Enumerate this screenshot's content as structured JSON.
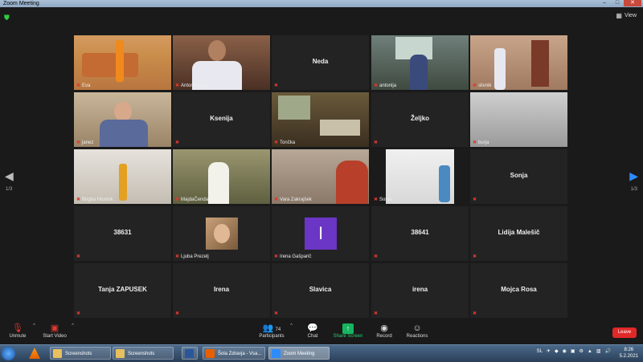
{
  "window": {
    "title": "Zoom Meeting"
  },
  "header": {
    "view_label": "View"
  },
  "pagination": {
    "left": "1/3",
    "right": "1/3"
  },
  "tiles": [
    {
      "name": "Eva",
      "type": "video",
      "video": "eva",
      "active": true
    },
    {
      "name": "Anton Cizej",
      "type": "video",
      "video": "anton"
    },
    {
      "name": "Neda",
      "type": "name"
    },
    {
      "name": "antonija",
      "type": "video",
      "video": "antonija"
    },
    {
      "name": "slivnik",
      "type": "video",
      "video": "slivnik"
    },
    {
      "name": "janez",
      "type": "video",
      "video": "janez"
    },
    {
      "name": "Ksenija",
      "type": "name"
    },
    {
      "name": "Tončka",
      "type": "video",
      "video": "toncka"
    },
    {
      "name": "Željko",
      "type": "name"
    },
    {
      "name": "burja",
      "type": "video",
      "video": "burja"
    },
    {
      "name": "Brigita Hostnik",
      "type": "video",
      "video": "brigita"
    },
    {
      "name": "MajdaČendak",
      "type": "video",
      "video": "majda"
    },
    {
      "name": "Vara Zakrajšek",
      "type": "video",
      "video": "vara"
    },
    {
      "name": "Sonja",
      "type": "video",
      "video": "sonja"
    },
    {
      "name": "Sonja",
      "type": "name"
    },
    {
      "name": "38631",
      "type": "name"
    },
    {
      "name": "Ljuba Prezelj",
      "type": "photo"
    },
    {
      "name": "Irena Gašparič",
      "type": "letter",
      "letter": "I"
    },
    {
      "name": "38641",
      "type": "name"
    },
    {
      "name": "Lidija Malešič",
      "type": "name"
    },
    {
      "name": "Tanja ZAPUSEK",
      "type": "name"
    },
    {
      "name": "Irena",
      "type": "name"
    },
    {
      "name": "Slavica",
      "type": "name"
    },
    {
      "name": "irena",
      "type": "name"
    },
    {
      "name": "Mojca Rosa",
      "type": "name"
    }
  ],
  "toolbar": {
    "unmute": "Unmute",
    "start_video": "Start Video",
    "participants": "Participants",
    "participants_count": "74",
    "chat": "Chat",
    "share_screen": "Share Screen",
    "record": "Record",
    "reactions": "Reactions",
    "leave": "Leave"
  },
  "taskbar": {
    "tasks": [
      {
        "label": "Screenshots",
        "icon": "folder-icon",
        "color": "#e8c060"
      },
      {
        "label": "Screenshots",
        "icon": "folder-icon",
        "color": "#e8c060"
      },
      {
        "label": "",
        "icon": "word-icon",
        "color": "#2b579a"
      },
      {
        "label": "Šola Zdravja - Vsa...",
        "icon": "firefox-icon",
        "color": "#e66000"
      },
      {
        "label": "Zoom Meeting",
        "icon": "zoom-icon",
        "color": "#2d8cff"
      }
    ],
    "language": "SL",
    "time": "8:26",
    "date": "5.2.2021"
  },
  "colors": {
    "active_border": "#e6e039",
    "leave": "#e02828",
    "share": "#17b460",
    "muted": "#e2382f"
  }
}
